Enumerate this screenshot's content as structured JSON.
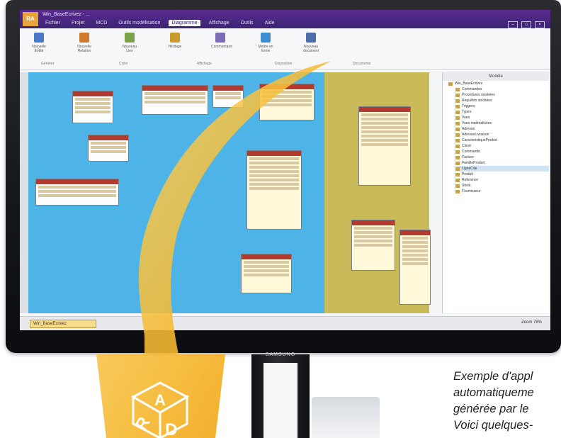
{
  "monitor": {
    "brand": "SAMSUNG"
  },
  "app": {
    "badge": "RA",
    "title": "Win_BaseEcrivez - ...",
    "tabs": [
      "Fichier",
      "Projet",
      "MCD",
      "Outils modélisation",
      "Diagramme",
      "Affichage",
      "Outils",
      "Aide"
    ],
    "active_tab": "Diagramme",
    "window_controls": [
      "minimize",
      "maximize",
      "close"
    ]
  },
  "ribbon": {
    "groups": [
      "Générer",
      "Créer",
      "Affichage",
      "Disposition",
      "Documents"
    ],
    "buttons": [
      {
        "label": "Nouvelle Entité",
        "icon": "entity-icon",
        "color": "#4a79c8"
      },
      {
        "label": "Nouvelle Relation",
        "icon": "relation-icon",
        "color": "#d07a2c"
      },
      {
        "label": "Nouveau Lien",
        "icon": "link-icon",
        "color": "#7aa24a"
      },
      {
        "label": "Héritage",
        "icon": "inherit-icon",
        "color": "#c99b2e"
      },
      {
        "label": "Commentaire",
        "icon": "comment-icon",
        "color": "#7d6bb5"
      },
      {
        "label": "Mettre en forme",
        "icon": "format-icon",
        "color": "#3b8fd1"
      },
      {
        "label": "Nouveau document",
        "icon": "document-icon",
        "color": "#4b6ea8"
      }
    ]
  },
  "panel": {
    "title": "Modèle",
    "items": [
      "Win_BaseEcrivez",
      "Commandes",
      "Procédures stockées",
      "Requêtes stockées",
      "Triggers",
      "Types",
      "Vues",
      "Vues matérialisées",
      "Adresse",
      "AdresseLivraison",
      "CaracteristiqueProduit",
      "Client",
      "Commande",
      "Facture",
      "FamilleProduit",
      "LigneCde",
      "Produit",
      "Reference",
      "Stock",
      "Fournisseur"
    ],
    "selected_index": 15
  },
  "status": {
    "doc_tab": "Win_BaseEcrivez",
    "zoom": "Zoom 78%"
  },
  "logo": {
    "letters": [
      "A",
      "R",
      "D"
    ]
  },
  "caption": {
    "lines": [
      "Exemple d'appl",
      "automatiqueme",
      "générée par le",
      "Voici quelques-"
    ]
  }
}
